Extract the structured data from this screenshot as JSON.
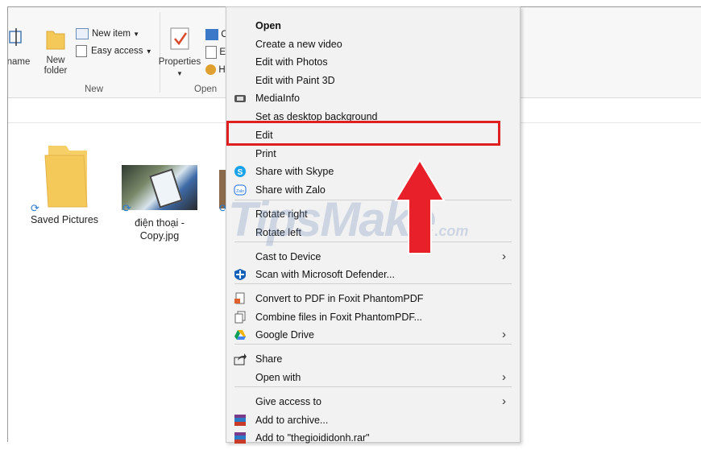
{
  "ribbon": {
    "rename_label": "name",
    "new_folder_label": "New\nfolder",
    "new_item_label": "New item",
    "easy_access_label": "Easy access",
    "new_group_label": "New",
    "properties_label": "Properties",
    "open_group_label": "Open",
    "open_cut_1": "O",
    "open_cut_2": "E",
    "open_cut_3": "H"
  },
  "files": [
    {
      "name": "Saved Pictures",
      "icon": "folder-icon"
    },
    {
      "name": "điện thoại -\nCopy.jpg",
      "icon": "image-thumbnail"
    }
  ],
  "watermark": {
    "text": "TipsMake",
    "suffix": ".com"
  },
  "context_menu": {
    "items": [
      {
        "label": "Open",
        "bold": true
      },
      {
        "label": "Create a new video"
      },
      {
        "label": "Edit with Photos"
      },
      {
        "label": "Edit with Paint 3D"
      },
      {
        "label": "MediaInfo",
        "icon": "mediainfo-icon"
      },
      {
        "label": "Set as desktop background"
      },
      {
        "label": "Edit"
      },
      {
        "label": "Print"
      },
      {
        "label": "Share with Skype",
        "icon": "skype-icon"
      },
      {
        "label": "Share with Zalo",
        "icon": "zalo-icon"
      },
      {
        "label": "Rotate right"
      },
      {
        "label": "Rotate left"
      },
      {
        "label": "Cast to Device",
        "submenu": true
      },
      {
        "label": "Scan with Microsoft Defender...",
        "icon": "defender-icon"
      },
      {
        "label": "Convert to PDF in Foxit PhantomPDF",
        "icon": "foxit-convert-icon"
      },
      {
        "label": "Combine files in Foxit PhantomPDF...",
        "icon": "foxit-combine-icon"
      },
      {
        "label": "Google Drive",
        "icon": "google-drive-icon",
        "submenu": true
      },
      {
        "label": "Share",
        "icon": "share-icon"
      },
      {
        "label": "Open with",
        "submenu": true
      },
      {
        "label": "Give access to",
        "submenu": true
      },
      {
        "label": "Add to archive...",
        "icon": "winrar-icon"
      },
      {
        "label": "Add to \"thegioididonh.rar\"",
        "icon": "winrar-icon"
      }
    ],
    "submenu_glyph": "›"
  },
  "colors": {
    "highlight": "#e02020",
    "arrow": "#e8202a",
    "menu_bg": "#f2f2f2",
    "folder": "#f5c85a"
  }
}
